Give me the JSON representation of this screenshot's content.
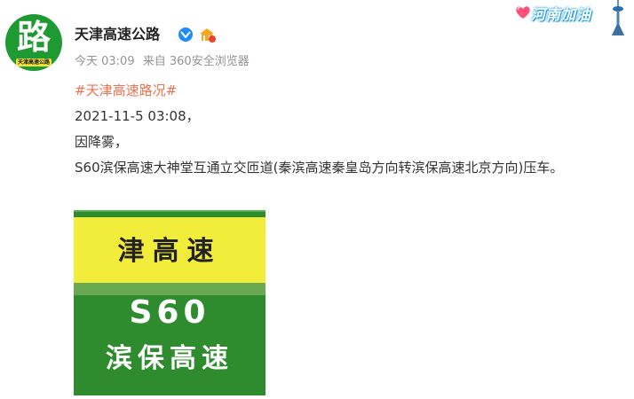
{
  "author": {
    "avatar_glyph": "路",
    "avatar_caption": "天津高速公路",
    "name": "天津高速公路",
    "verified_icon": "verified-icon",
    "badge_icon": "gov-badge-icon"
  },
  "meta": {
    "time": "今天 03:09",
    "source": "来自 360安全浏览器"
  },
  "topic_banner": {
    "text": "河南加油",
    "icons": [
      "heart-icon",
      "tower-icon"
    ]
  },
  "post": {
    "hashtag": "#天津高速路况#",
    "line1": "2021-11-5 03:08，",
    "line2": "因降雾，",
    "line3": "S60滨保高速大神堂互通立交匝道(秦滨高速秦皇岛方向转滨保高速北京方向)压车。"
  },
  "sign": {
    "top_text": "津高速",
    "route": "S60",
    "name": "滨保高速"
  },
  "colors": {
    "hashtag": "#eb7350",
    "meta": "#939393",
    "sign_yellow": "#f2ec3a",
    "sign_green": "#2e8b2e",
    "verified": "#1e8cff"
  }
}
